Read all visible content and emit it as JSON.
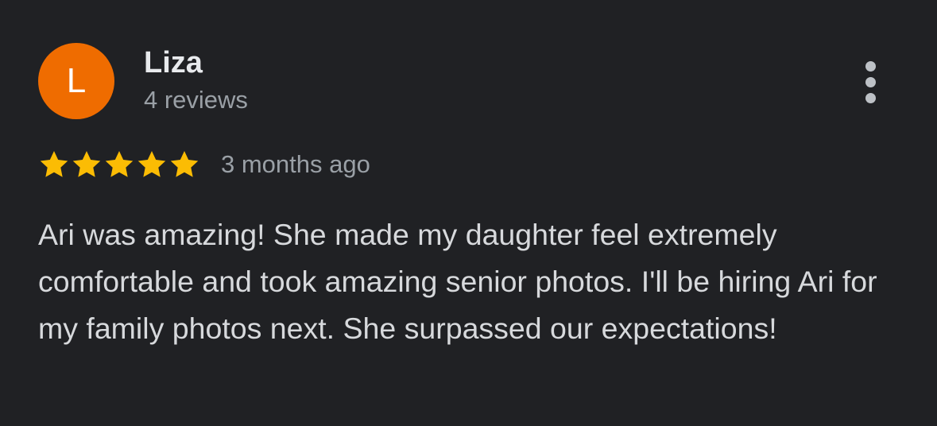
{
  "review": {
    "author": {
      "initial": "L",
      "name": "Liza",
      "review_count": "4 reviews"
    },
    "rating": 5,
    "date": "3 months ago",
    "text": "Ari was amazing! She made my daughter feel extremely comfortable and took amazing senior photos. I'll be hiring Ari for my family photos next. She surpassed our expectations!"
  },
  "colors": {
    "background": "#202124",
    "avatar": "#ef6c00",
    "star": "#fbbc04"
  },
  "icons": {
    "more": "more-vertical-icon",
    "star": "star-icon"
  }
}
